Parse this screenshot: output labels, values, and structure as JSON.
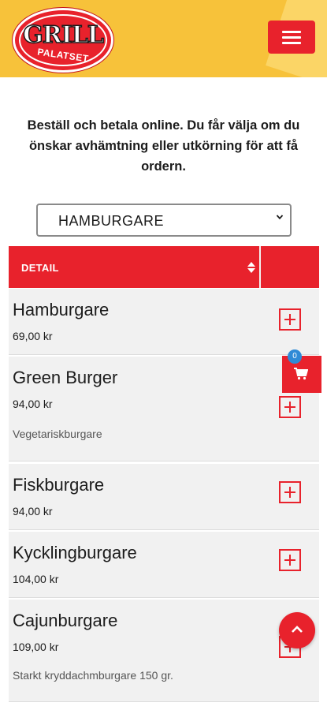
{
  "header": {
    "logo_main": "GRILL",
    "logo_sub": "PALATSET"
  },
  "intro": "Beställ och betala online. Du får välja om du önskar avhämtning eller utkörning för att få ordern.",
  "category_select": {
    "selected": "HAMBURGARE"
  },
  "table": {
    "header_detail": "DETAIL"
  },
  "products": [
    {
      "name": "Hamburgare",
      "price": "69,00 kr",
      "description": ""
    },
    {
      "name": "Green Burger",
      "price": "94,00 kr",
      "description": "Vegetariskburgare"
    },
    {
      "name": "Fiskburgare",
      "price": "94,00 kr",
      "description": ""
    },
    {
      "name": "Kycklingburgare",
      "price": "104,00 kr",
      "description": ""
    },
    {
      "name": "Cajunburgare",
      "price": "109,00 kr",
      "description": "Starkt kryddachmburgare 150 gr."
    }
  ],
  "cart": {
    "count": "0"
  },
  "icons": {
    "menu": "hamburger-menu-icon",
    "cart": "shopping-cart-icon",
    "add": "plus-square-icon",
    "sort": "sort-icon",
    "dropdown": "chevron-down-icon",
    "to_top": "chevron-up-icon"
  },
  "colors": {
    "brand_red": "#e8222c",
    "header_yellow": "#f7c23a",
    "row_bg": "#f1f1f1",
    "badge_blue": "#2f8ad6"
  }
}
